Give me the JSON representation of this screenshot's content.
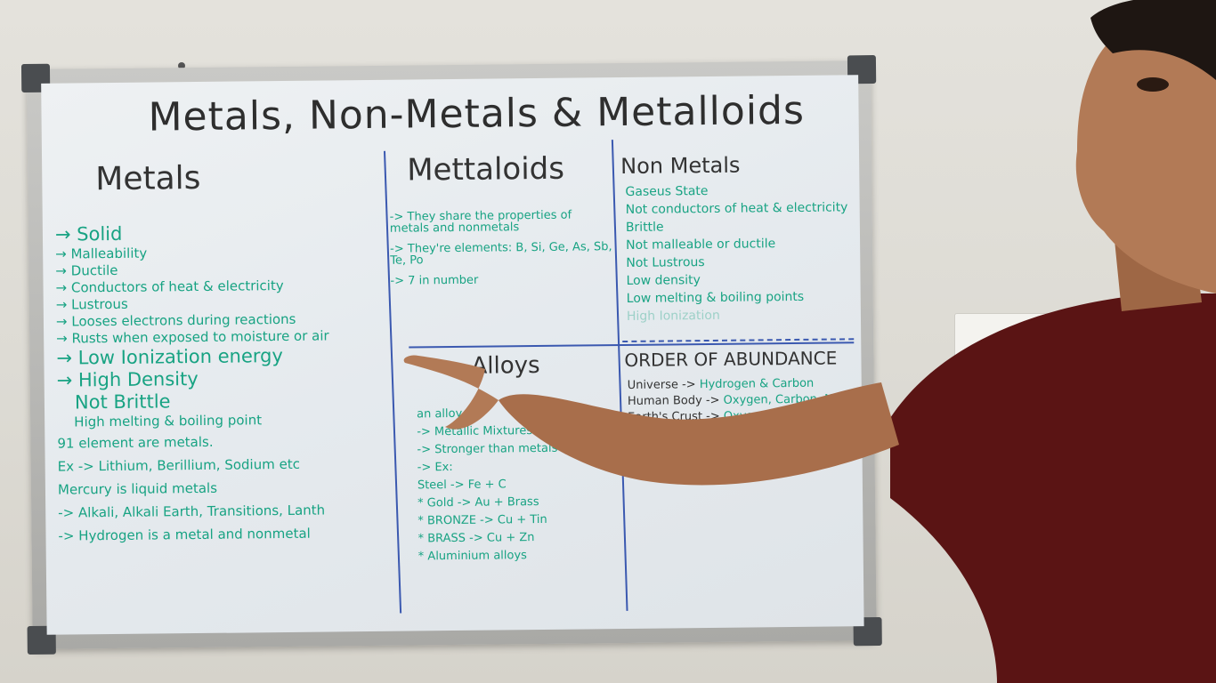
{
  "board": {
    "title": "Metals, Non-Metals & Metalloids",
    "metals": {
      "heading": "Metals",
      "items": [
        "Solid",
        "Malleability",
        "Ductile",
        "Conductors of heat & electricity",
        "Lustrous",
        "Looses electrons during reactions",
        "Rusts when exposed to moisture or air",
        "Low Ionization energy",
        "High Density",
        "Not Brittle",
        "High melting & boiling point"
      ],
      "notes": [
        "91 element are metals.",
        "Ex -> Lithium, Berillium, Sodium etc",
        "Mercury is liquid metals",
        "-> Alkali, Alkali Earth, Transitions, Lanth",
        "-> Hydrogen is a metal and nonmetal"
      ]
    },
    "metalloids": {
      "heading": "Mettaloids",
      "items": [
        "-> They share the properties of metals and nonmetals",
        "-> They're elements: B, Si, Ge, As, Sb, Te, Po",
        "-> 7 in number"
      ]
    },
    "nonmetals": {
      "heading": "Non Metals",
      "items": [
        "Gaseus State",
        "Not conductors of heat & electricity",
        "Brittle",
        "Not malleable or ductile",
        "Not Lustrous",
        "Low density",
        "Low melting & boiling points",
        "High Ionization"
      ]
    },
    "alloys": {
      "heading": "Alloys",
      "items": [
        "an alloy",
        "-> Metallic Mixtures",
        "-> Stronger than metals",
        "-> Ex:",
        "Steel -> Fe + C",
        "* Gold -> Au + Brass",
        "* BRONZE -> Cu + Tin",
        "* BRASS -> Cu + Zn",
        "* Aluminium alloys"
      ]
    },
    "abundance": {
      "heading": "ORDER OF ABUNDANCE",
      "rows": [
        {
          "label": "Universe ->",
          "value": "Hydrogen & Carbon"
        },
        {
          "label": "Human Body ->",
          "value": "Oxygen, Carbon, Nitrogen, Hydrogen"
        },
        {
          "label": "Earth's Crust ->",
          "value": "Oxygen"
        }
      ]
    }
  },
  "colors": {
    "marker_green": "#18a383",
    "marker_black": "#333333",
    "marker_blue": "#3b59b0",
    "shirt": "#5a1414",
    "skin": "#b27a56"
  }
}
